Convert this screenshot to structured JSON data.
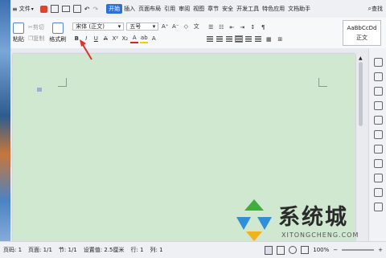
{
  "menubar": {
    "file_label": "文件",
    "tabs": [
      "开始",
      "插入",
      "页面布局",
      "引用",
      "审阅",
      "视图",
      "章节",
      "安全",
      "开发工具",
      "特色应用",
      "文档助手"
    ],
    "active_tab": "开始",
    "search_label": "查找"
  },
  "ribbon": {
    "paste_label": "粘贴",
    "cut_label": "剪切",
    "copy_label": "复制",
    "format_painter_label": "格式刷",
    "font_name": "宋体 (正文)",
    "font_size": "五号",
    "style_preview": "AaBbCcDd",
    "style_name": "正文"
  },
  "status": {
    "page_num": "页码: 1",
    "page": "页面: 1/1",
    "section": "节: 1/1",
    "setting": "设置值: 2.5厘米",
    "row": "行: 1",
    "col": "列: 1",
    "zoom": "100%"
  },
  "watermark": {
    "title": "系统城",
    "url": "XITONGCHENG.COM"
  },
  "colors": {
    "page_bg": "#cfe8cf",
    "accent": "#2b6fd8",
    "annotation_arrow": "#e0302a"
  }
}
